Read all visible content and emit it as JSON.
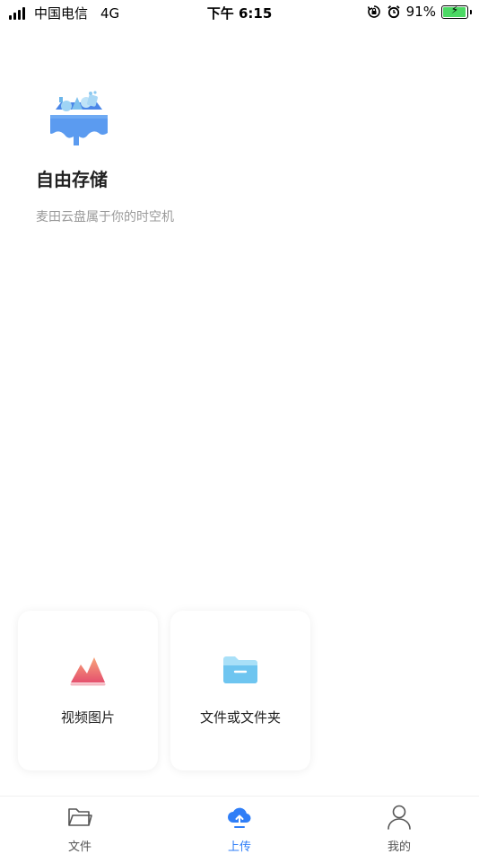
{
  "status_bar": {
    "carrier": "中国电信",
    "network": "4G",
    "time": "下午 6:15",
    "battery": "91%",
    "icons": [
      "signal-icon",
      "orientation-lock-icon",
      "alarm-icon",
      "battery-icon"
    ]
  },
  "hero": {
    "title": "自由存储",
    "subtitle": "麦田云盘属于你的时空机"
  },
  "upload_options": [
    {
      "label": "视频图片",
      "icon": "media-mountain-icon"
    },
    {
      "label": "文件或文件夹",
      "icon": "folder-icon"
    }
  ],
  "tabbar": {
    "tabs": [
      {
        "label": "文件",
        "icon": "folder-outline-icon",
        "active": false
      },
      {
        "label": "上传",
        "icon": "cloud-upload-icon",
        "active": true
      },
      {
        "label": "我的",
        "icon": "user-icon",
        "active": false
      }
    ]
  },
  "colors": {
    "accent": "#2f7ef7",
    "hero_blue": "#5b9bf0",
    "media_icon": "#ec6a7e",
    "folder_icon": "#6ec5f0",
    "subtitle_gray": "#9a9a9a"
  }
}
